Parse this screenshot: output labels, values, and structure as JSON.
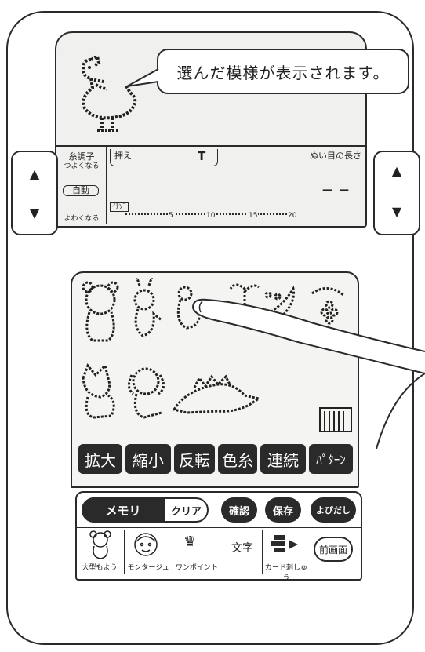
{
  "callout": "選んだ模様が表示されます。",
  "tension": {
    "label": "糸調子",
    "up": "つよくなる",
    "auto": "自動",
    "down": "よわくなる"
  },
  "presser": {
    "label": "押え",
    "foot": "T"
  },
  "scale": {
    "marks": [
      "5",
      "10",
      "15",
      "20"
    ],
    "tag": "ｲﾁｿﾞ"
  },
  "stitch_length": {
    "label": "ぬい目の長さ",
    "value": "− −"
  },
  "side_buttons": {
    "up": "▲",
    "down": "▼"
  },
  "function_keys": [
    "拡大",
    "縮小",
    "反転",
    "色糸",
    "連続",
    "ﾊﾟﾀｰﾝ"
  ],
  "controls": {
    "memory": "メモリ",
    "clear": "クリア",
    "confirm": "確認",
    "save": "保存",
    "recall": "よびだし"
  },
  "categories": [
    "大型もよう",
    "モンタージュ",
    "ワンポイント",
    "文字",
    "カード刺しゅう",
    "前画面"
  ]
}
